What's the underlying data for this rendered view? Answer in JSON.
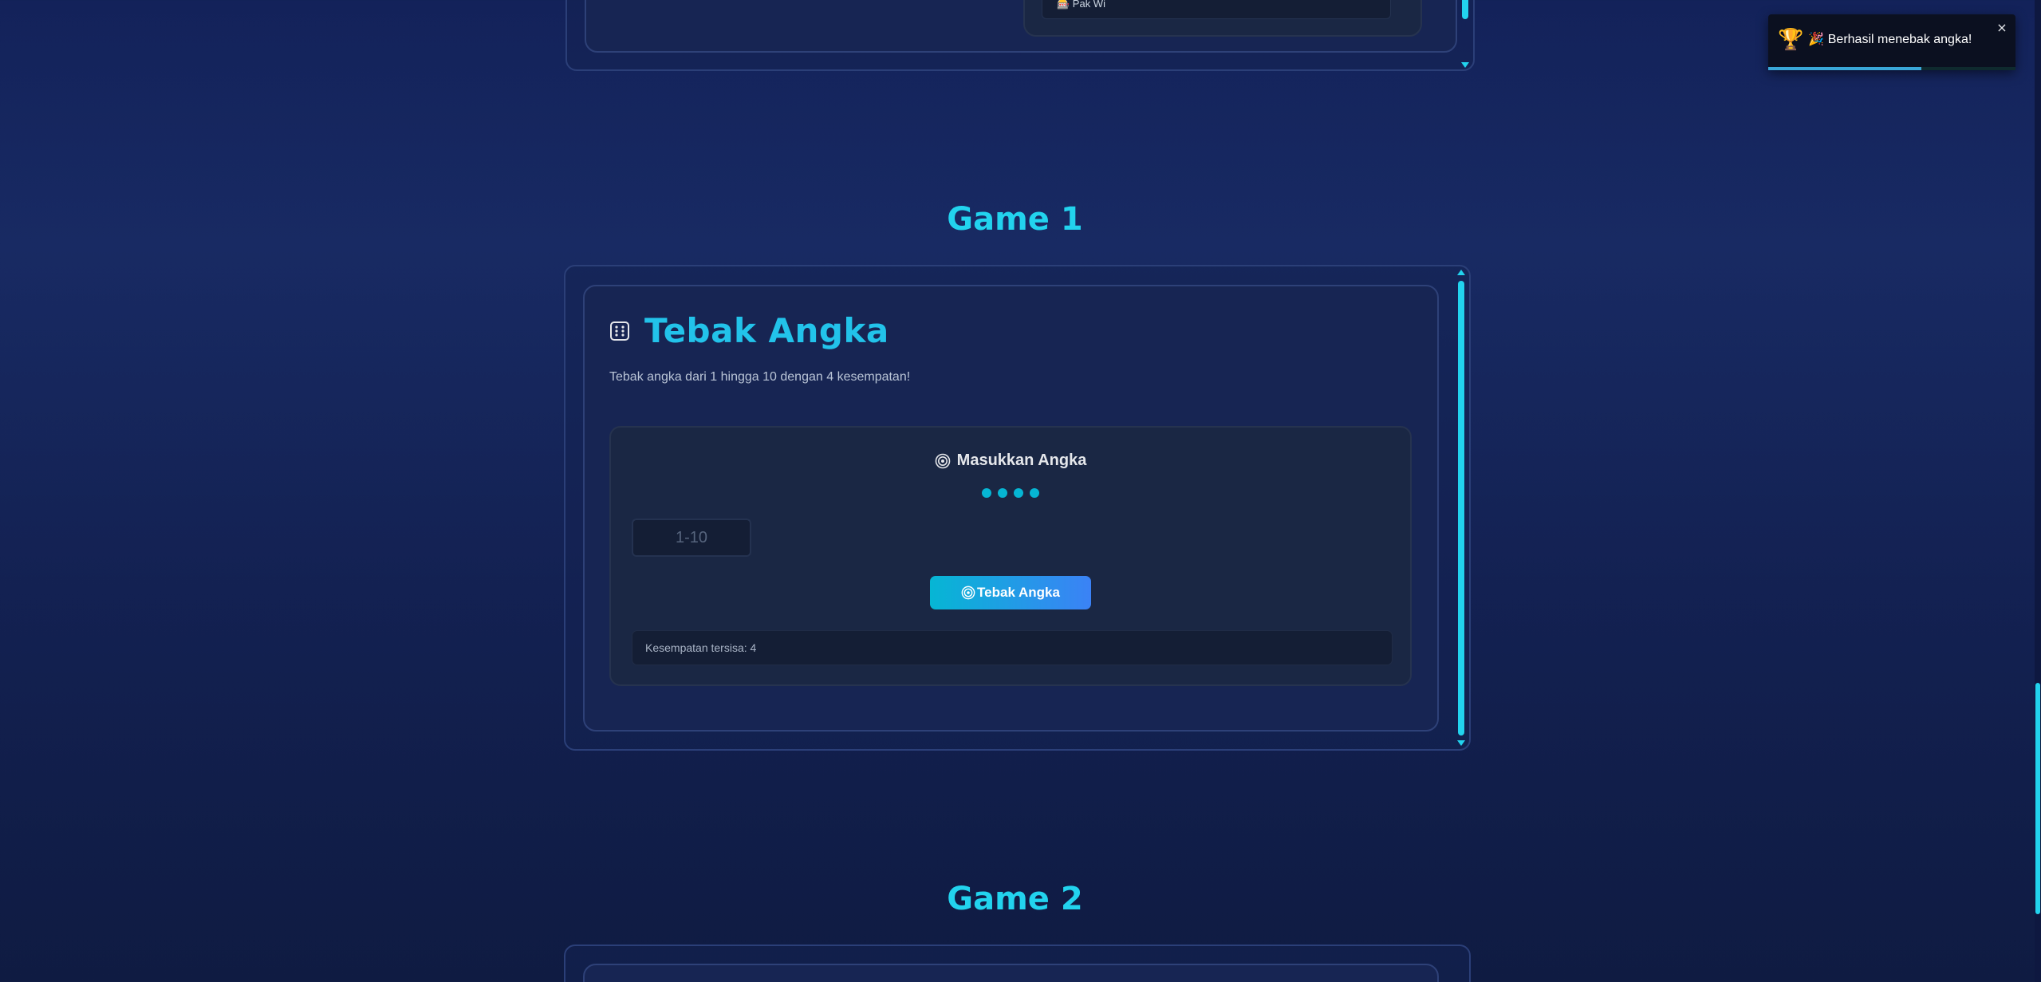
{
  "top_fragment": {
    "text": "🎰 Pak Wi"
  },
  "sections": {
    "game1_heading": "Game 1",
    "game2_heading": "Game 2"
  },
  "game": {
    "title": "Tebak Angka",
    "description": "Tebak angka dari 1 hingga 10 dengan 4 kesempatan!",
    "input_heading": "Masukkan Angka",
    "dots_remaining": 4,
    "input_placeholder": "1-10",
    "input_value": "",
    "guess_button_label": "Tebak Angka",
    "status_text": "Kesempatan tersisa: 4"
  },
  "toast": {
    "message": "🎉 Berhasil menebak angka!",
    "close_label": "×",
    "progress_fraction": 0.62
  },
  "icons": {
    "die": "die-icon",
    "target": "target-icon",
    "trophy": "trophy-icon",
    "trophy_glyph": "🏆"
  },
  "colors": {
    "accent": "#22d3ee",
    "button_gradient_start": "#06b6d4",
    "button_gradient_end": "#3b82f6"
  }
}
